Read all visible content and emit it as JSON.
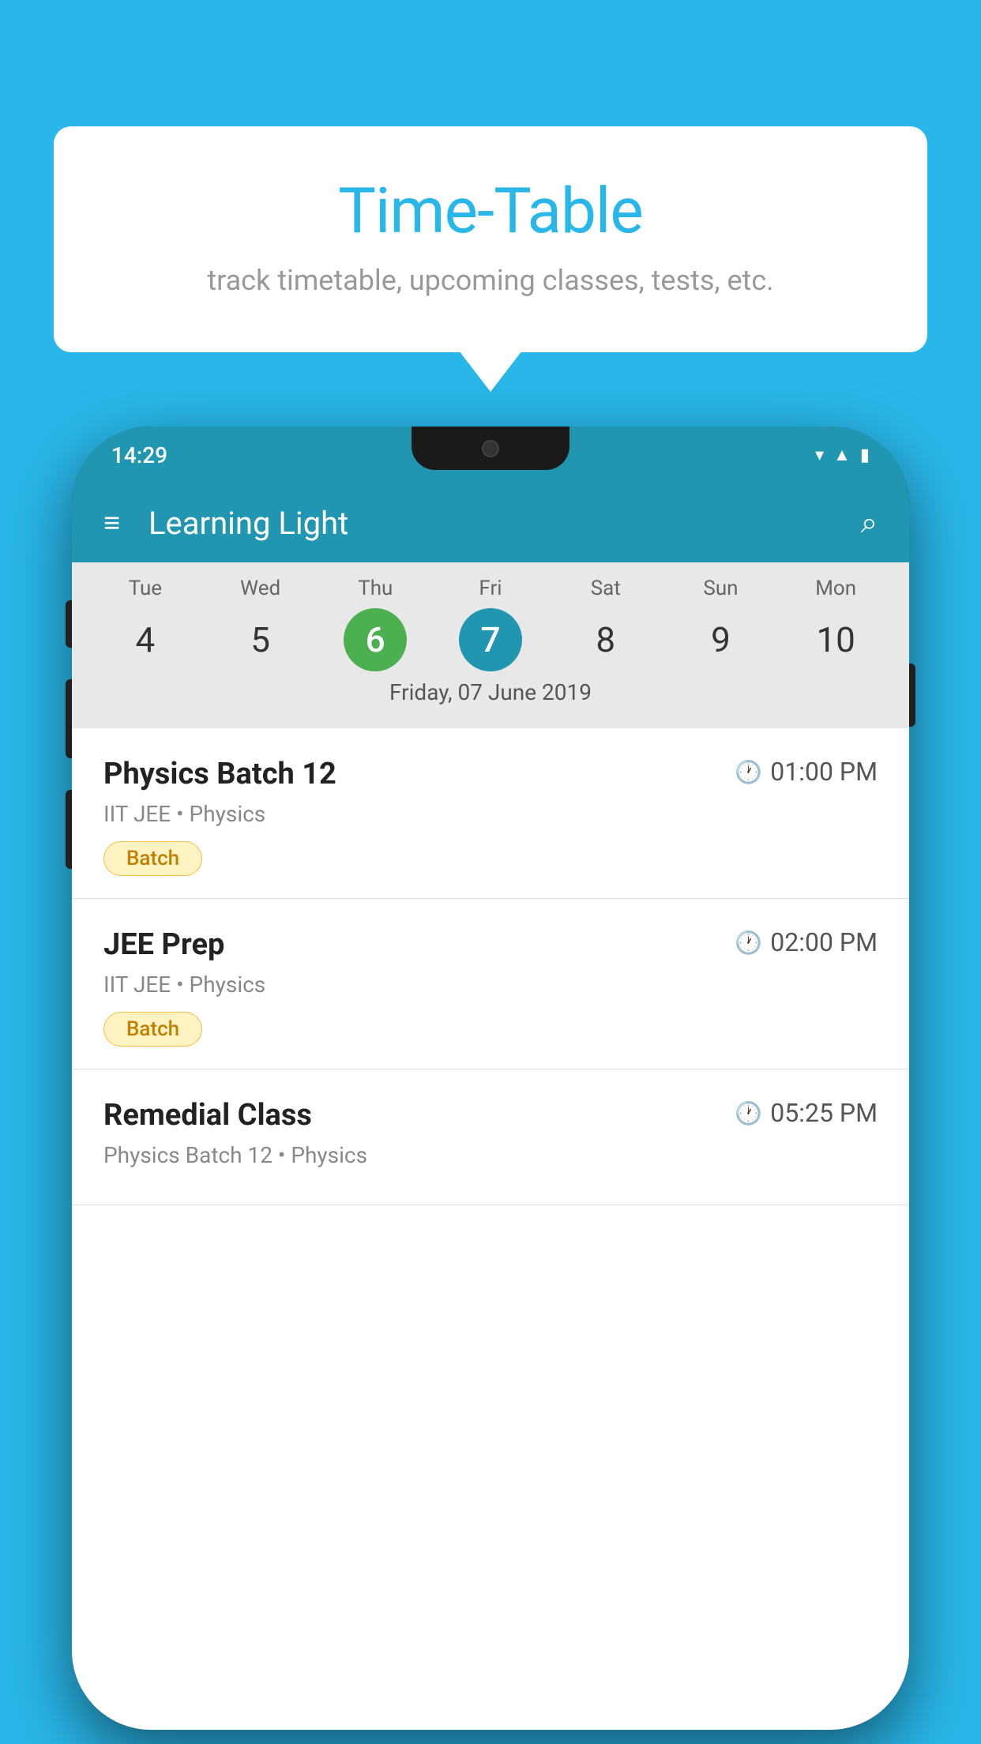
{
  "background_color": "#29b6e8",
  "tooltip": {
    "title": "Time-Table",
    "subtitle": "track timetable, upcoming classes, tests, etc."
  },
  "app": {
    "status_time": "14:29",
    "bar_title": "Learning Light",
    "hamburger_label": "≡",
    "search_label": "🔍"
  },
  "calendar": {
    "days": [
      {
        "name": "Tue",
        "number": "4",
        "state": "normal"
      },
      {
        "name": "Wed",
        "number": "5",
        "state": "normal"
      },
      {
        "name": "Thu",
        "number": "6",
        "state": "today"
      },
      {
        "name": "Fri",
        "number": "7",
        "state": "selected"
      },
      {
        "name": "Sat",
        "number": "8",
        "state": "normal"
      },
      {
        "name": "Sun",
        "number": "9",
        "state": "normal"
      },
      {
        "name": "Mon",
        "number": "10",
        "state": "normal"
      }
    ],
    "selected_date": "Friday, 07 June 2019"
  },
  "classes": [
    {
      "name": "Physics Batch 12",
      "time": "01:00 PM",
      "subtitle": "IIT JEE • Physics",
      "tag": "Batch"
    },
    {
      "name": "JEE Prep",
      "time": "02:00 PM",
      "subtitle": "IIT JEE • Physics",
      "tag": "Batch"
    },
    {
      "name": "Remedial Class",
      "time": "05:25 PM",
      "subtitle": "Physics Batch 12 • Physics",
      "tag": ""
    }
  ]
}
